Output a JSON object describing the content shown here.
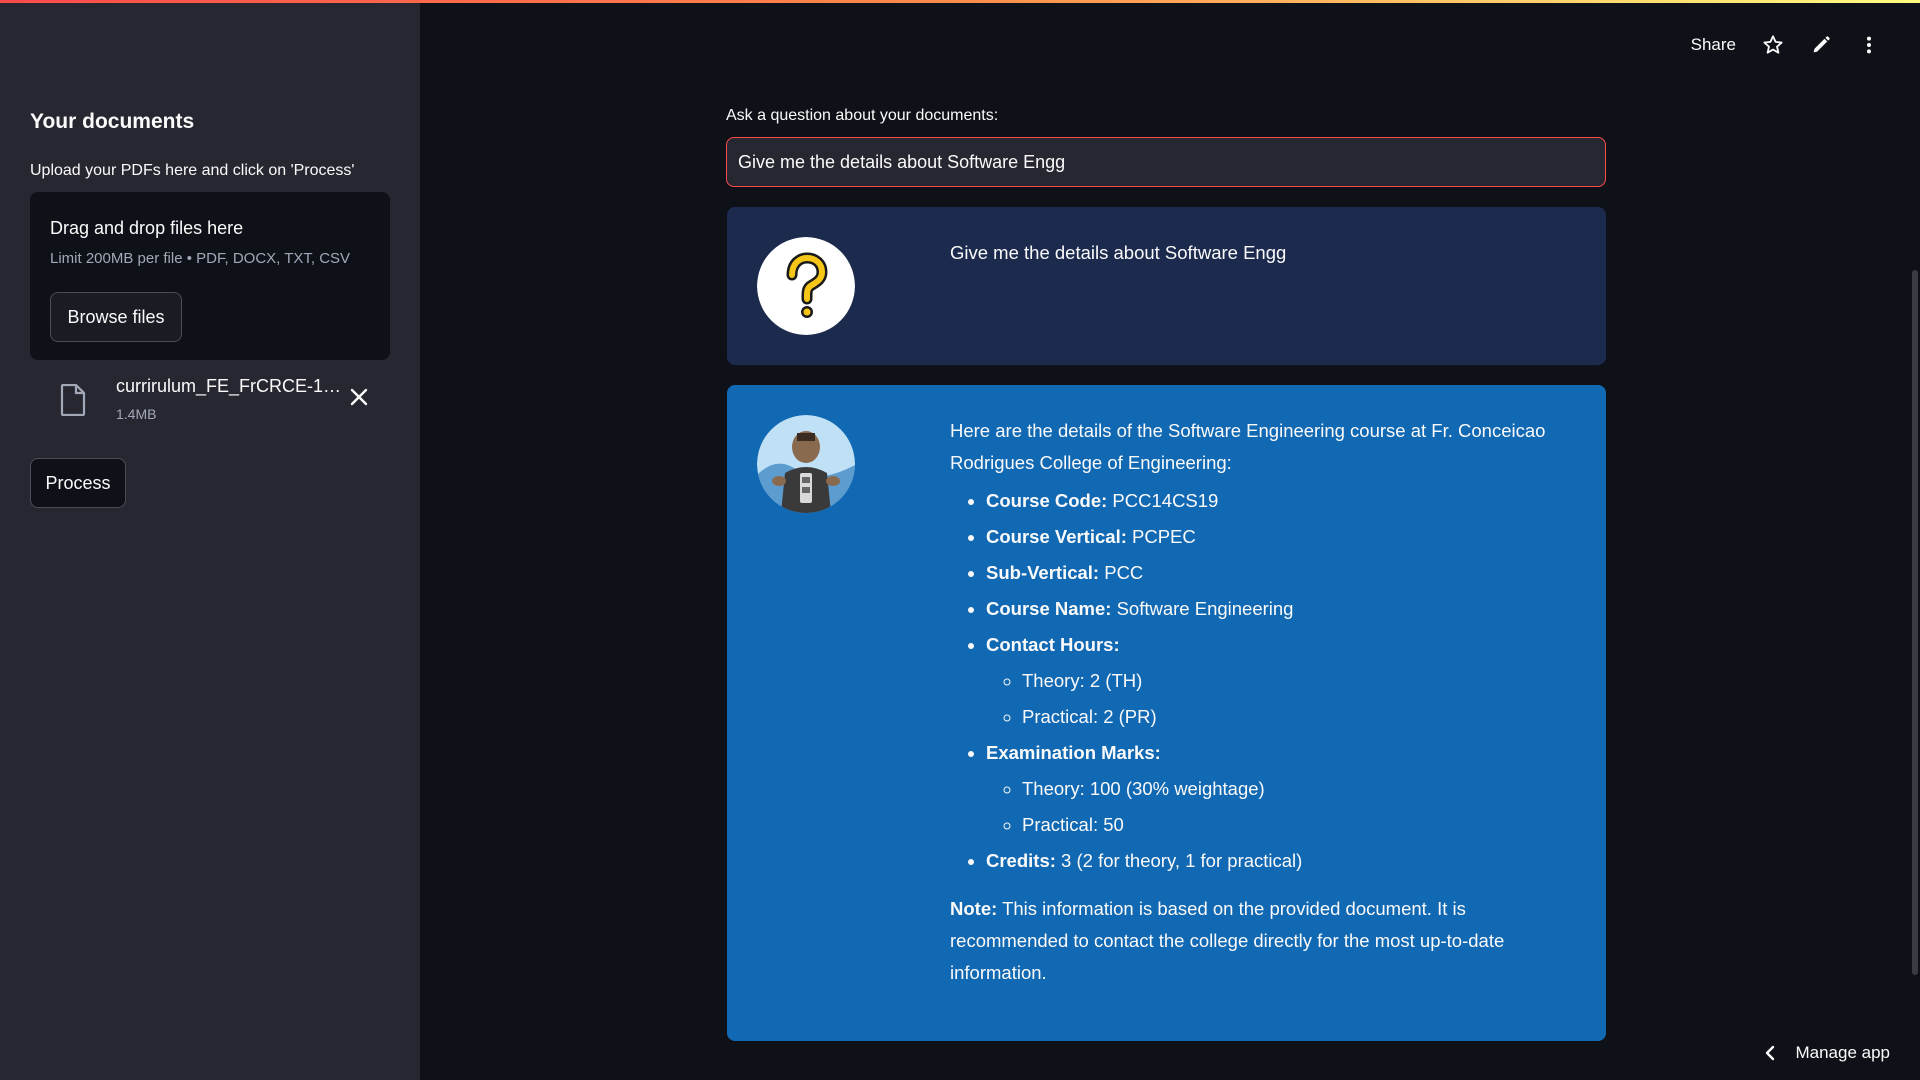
{
  "header": {
    "share_label": "Share",
    "icons": [
      "star-icon",
      "pencil-icon",
      "kebab-menu-icon"
    ]
  },
  "sidebar": {
    "title": "Your documents",
    "subtitle": "Upload your PDFs here and click on 'Process'",
    "uploader": {
      "title": "Drag and drop files here",
      "limit": "Limit 200MB per file • PDF, DOCX, TXT, CSV",
      "browse_label": "Browse files"
    },
    "file": {
      "name": "currirulum_FE_FrCRCE-1…",
      "size": "1.4MB"
    },
    "process_label": "Process"
  },
  "main": {
    "question_label": "Ask a question about your documents:",
    "question_value": "Give me the details about Software Engg",
    "user_message": "Give me the details about Software Engg",
    "bot": {
      "intro": "Here are the details of the Software Engineering course at Fr. Conceicao Rodrigues College of Engineering:",
      "code_label": "Course Code:",
      "code_value": " PCC14CS19",
      "vertical_label": "Course Vertical:",
      "vertical_value": " PCPEC",
      "subvertical_label": "Sub-Vertical:",
      "subvertical_value": " PCC",
      "name_label": "Course Name:",
      "name_value": " Software Engineering",
      "contact_label": "Contact Hours:",
      "contact_theory": "Theory: 2 (TH)",
      "contact_practical": "Practical: 2 (PR)",
      "exam_label": "Examination Marks:",
      "exam_theory": "Theory: 100 (30% weightage)",
      "exam_practical": "Practical: 50",
      "credits_label": "Credits:",
      "credits_value": " 3 (2 for theory, 1 for practical)",
      "note_label": "Note:",
      "note_value": " This information is based on the provided document. It is recommended to contact the college directly for the most up-to-date information."
    }
  },
  "footer": {
    "manage_label": "Manage app"
  },
  "colors": {
    "background": "#0e1117",
    "sidebar": "#262730",
    "user_message_bg": "#1c2a4e",
    "bot_message_bg": "#1168b3",
    "accent": "#ff4b4b"
  }
}
